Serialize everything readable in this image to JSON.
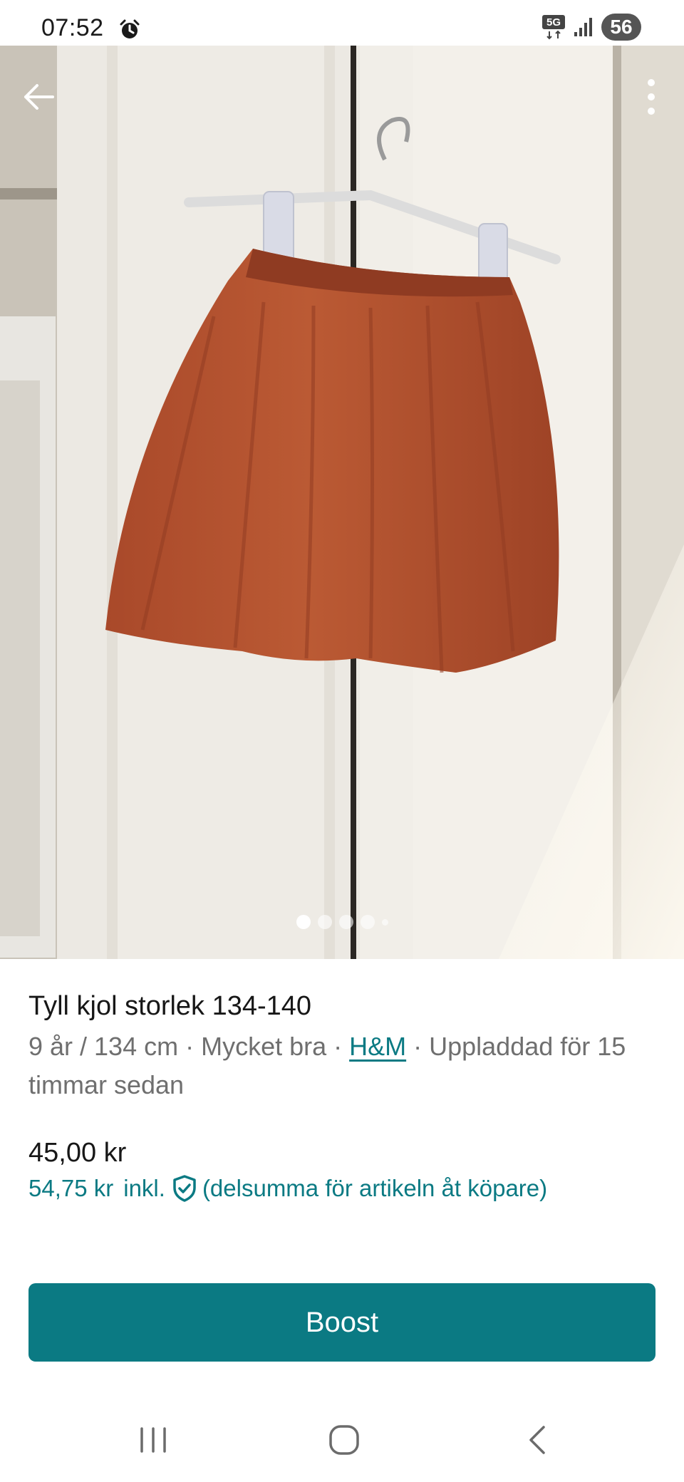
{
  "status_bar": {
    "time": "07:52",
    "network": "5G",
    "battery": "56",
    "icons": [
      "alarm-icon",
      "5g-data-icon",
      "signal-icon",
      "battery-icon"
    ]
  },
  "photo": {
    "pager": {
      "count": 5,
      "active_index": 0
    },
    "icons": [
      "back-arrow-icon",
      "more-vertical-icon"
    ]
  },
  "item": {
    "title": "Tyll kjol storlek 134-140",
    "meta_prefix": "9 år / 134 cm · Mycket bra · ",
    "brand": "H&M",
    "meta_suffix": " · Uppladdad för 15 timmar sedan",
    "price": "45,00 kr",
    "price_incl_amount": "54,75 kr",
    "price_incl_label": "inkl.",
    "price_incl_note": "(delsumma för artikeln åt köpare)"
  },
  "actions": {
    "boost_label": "Boost"
  },
  "colors": {
    "accent": "#0b7a83",
    "skirt": "#b5532f",
    "text": "#171717",
    "muted": "#6f6f6f"
  }
}
